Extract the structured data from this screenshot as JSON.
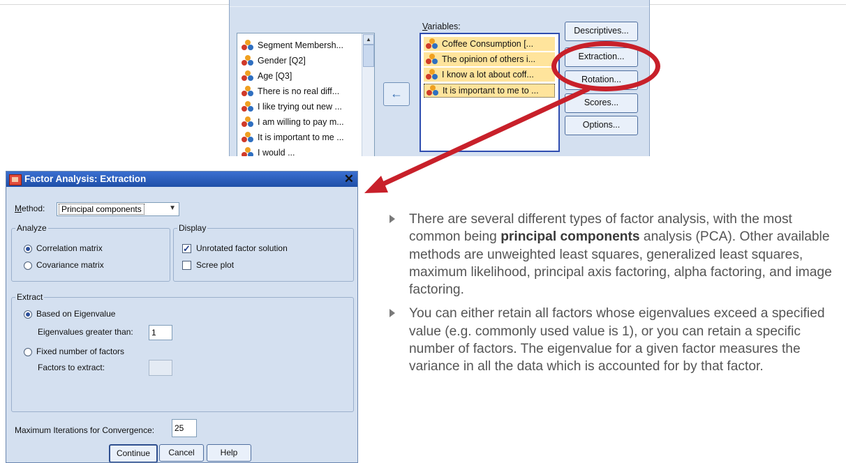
{
  "variables_dialog": {
    "variable_list": [
      "Segment Membersh...",
      "Gender [Q2]",
      "Age [Q3]",
      "There is no real diff...",
      "I like trying out new ...",
      "I am willing to pay m...",
      "It is important to me ...",
      "I would ..."
    ],
    "move_button_glyph": "←",
    "variables_label": "Variables:",
    "selected_variables": [
      "Coffee Consumption [...",
      "The opinion of others i...",
      "I know a lot about coff...",
      "It is important to me to ..."
    ],
    "buttons": {
      "descriptives": "Descriptives...",
      "extraction": "Extraction...",
      "rotation": "Rotation...",
      "scores": "Scores...",
      "options": "Options..."
    },
    "highlight_color": "#c8202a"
  },
  "extraction_dialog": {
    "title": "Factor Analysis: Extraction",
    "close_glyph": "✕",
    "method_label": "Method:",
    "method_value": "Principal components",
    "analyze": {
      "title": "Analyze",
      "correlation": "Correlation matrix",
      "covariance": "Covariance matrix",
      "selected": "correlation"
    },
    "display": {
      "title": "Display",
      "unrotated": "Unrotated factor solution",
      "unrotated_checked": true,
      "scree": "Scree plot",
      "scree_checked": false
    },
    "extract": {
      "title": "Extract",
      "based_on_eigenvalue": "Based on Eigenvalue",
      "eigen_greater_label": "Eigenvalues greater than:",
      "eigen_value": "1",
      "fixed_number": "Fixed number of factors",
      "factors_label": "Factors to extract:",
      "factors_value": "",
      "selected": "eigenvalue"
    },
    "max_iter_label": "Maximum Iterations for Convergence:",
    "max_iter_value": "25",
    "buttons": {
      "continue": "Continue",
      "cancel": "Cancel",
      "help": "Help"
    }
  },
  "bullets": {
    "b1_pre": "There are several different types of factor analysis, with the most common being ",
    "b1_bold": "principal components",
    "b1_post": " analysis (PCA). Other available methods are unweighted least squares, generalized least squares, maximum likelihood, principal axis factoring, alpha factoring, and image factoring.",
    "b2": "You can either retain all factors whose eigenvalues exceed a specified value (e.g. commonly used value is 1), or you can retain a specific number of factors. The eigenvalue for a given factor measures the variance in all the data which is accounted for by that factor."
  }
}
